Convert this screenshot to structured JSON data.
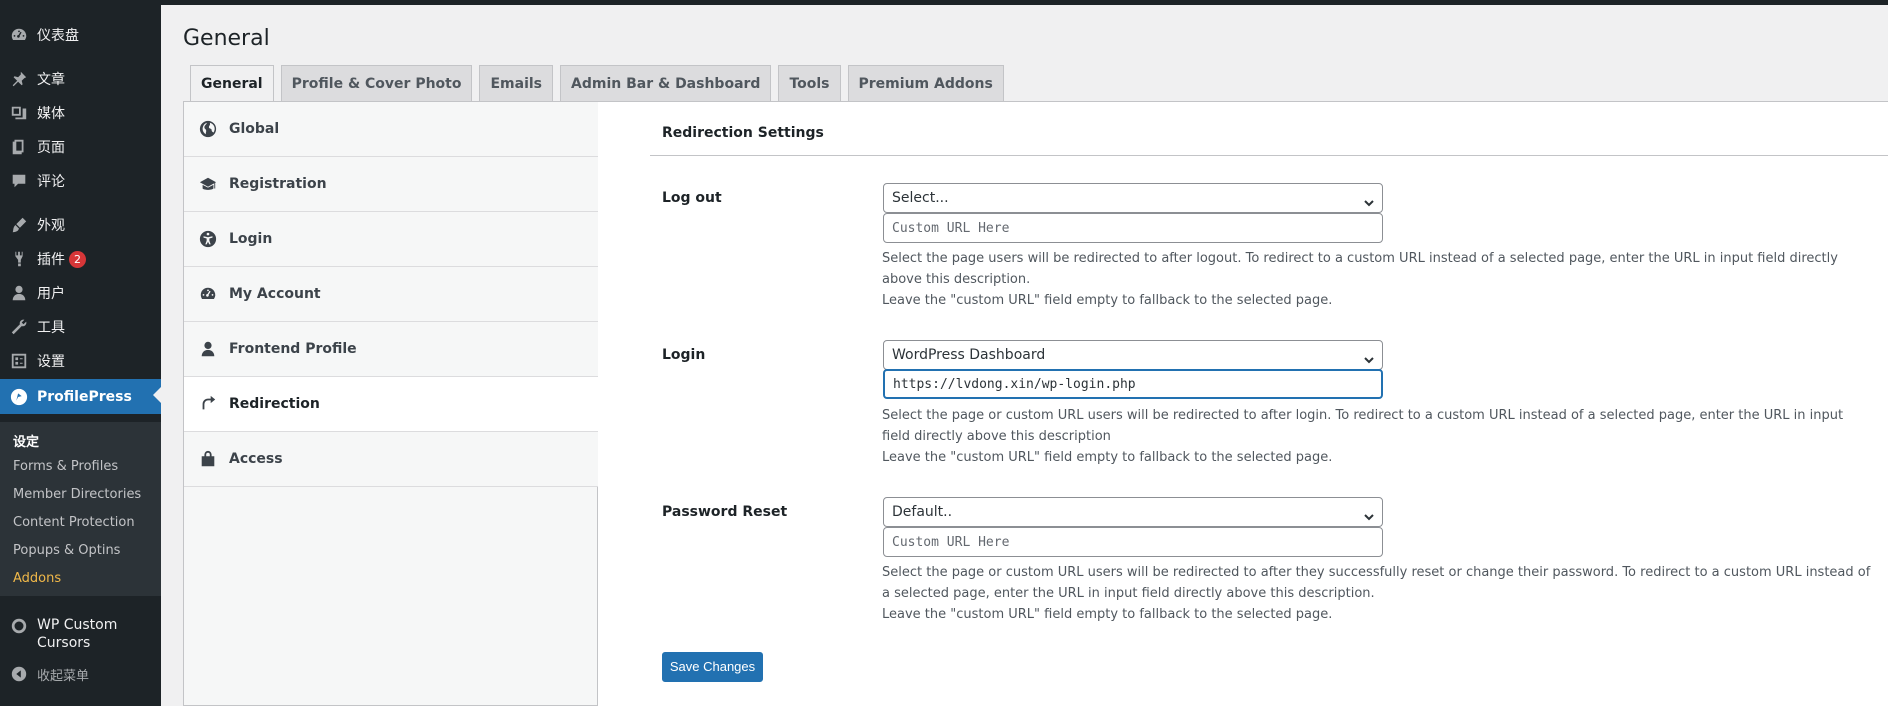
{
  "sidebar": {
    "items": [
      {
        "label": "仪表盘",
        "icon": "dashboard-icon"
      },
      {
        "label": "文章",
        "icon": "pin-icon"
      },
      {
        "label": "媒体",
        "icon": "media-icon"
      },
      {
        "label": "页面",
        "icon": "pages-icon"
      },
      {
        "label": "评论",
        "icon": "comment-icon"
      },
      {
        "label": "外观",
        "icon": "brush-icon"
      },
      {
        "label": "插件",
        "icon": "plugin-icon",
        "badge": "2"
      },
      {
        "label": "用户",
        "icon": "user-icon"
      },
      {
        "label": "工具",
        "icon": "wrench-icon"
      },
      {
        "label": "设置",
        "icon": "settings-icon"
      },
      {
        "label": "ProfilePress",
        "icon": "profilepress-icon",
        "active": true
      }
    ],
    "submenu": [
      {
        "label": "设定",
        "current": true
      },
      {
        "label": "Forms & Profiles"
      },
      {
        "label": "Member Directories"
      },
      {
        "label": "Content Protection"
      },
      {
        "label": "Popups & Optins"
      },
      {
        "label": "Addons",
        "highlight": true
      }
    ],
    "extra": {
      "label": "WP Custom Cursors",
      "icon": "circle-icon"
    },
    "collapse": {
      "label": "收起菜单",
      "icon": "collapse-icon"
    }
  },
  "page": {
    "title": "General"
  },
  "tabs": [
    {
      "label": "General",
      "active": true
    },
    {
      "label": "Profile & Cover Photo"
    },
    {
      "label": "Emails"
    },
    {
      "label": "Admin Bar & Dashboard"
    },
    {
      "label": "Tools"
    },
    {
      "label": "Premium Addons"
    }
  ],
  "nav": [
    {
      "label": "Global",
      "icon": "globe-icon"
    },
    {
      "label": "Registration",
      "icon": "graduation-cap-icon"
    },
    {
      "label": "Login",
      "icon": "universal-access-icon"
    },
    {
      "label": "My Account",
      "icon": "dashboard-gauge-icon"
    },
    {
      "label": "Frontend Profile",
      "icon": "person-icon"
    },
    {
      "label": "Redirection",
      "icon": "redo-arrow-icon",
      "active": true
    },
    {
      "label": "Access",
      "icon": "store-icon"
    }
  ],
  "section": {
    "title": "Redirection Settings"
  },
  "fields": {
    "logout": {
      "label": "Log out",
      "select": "Select...",
      "url_value": "",
      "placeholder": "Custom URL Here",
      "desc1": "Select the page users will be redirected to after logout. To redirect to a custom URL instead of a selected page, enter the URL in input field directly above this description.",
      "desc2": "Leave the \"custom URL\" field empty to fallback to the selected page."
    },
    "login": {
      "label": "Login",
      "select": "WordPress Dashboard",
      "url_value": "https://lvdong.xin/wp-login.php",
      "placeholder": "Custom URL Here",
      "desc1": "Select the page or custom URL users will be redirected to after login. To redirect to a custom URL instead of a selected page, enter the URL in input field directly above this description",
      "desc2": "Leave the \"custom URL\" field empty to fallback to the selected page."
    },
    "reset": {
      "label": "Password Reset",
      "select": "Default..",
      "url_value": "",
      "placeholder": "Custom URL Here",
      "desc1": "Select the page or custom URL users will be redirected to after they successfully reset or change their password. To redirect to a custom URL instead of a selected page, enter the URL in input field directly above this description.",
      "desc2": "Leave the \"custom URL\" field empty to fallback to the selected page."
    }
  },
  "save_label": "Save Changes",
  "colors": {
    "accent": "#2271b1",
    "sidebar_bg": "#1d2327",
    "submenu_bg": "#2c3338",
    "badge": "#d63638",
    "addons": "#f0b849"
  }
}
